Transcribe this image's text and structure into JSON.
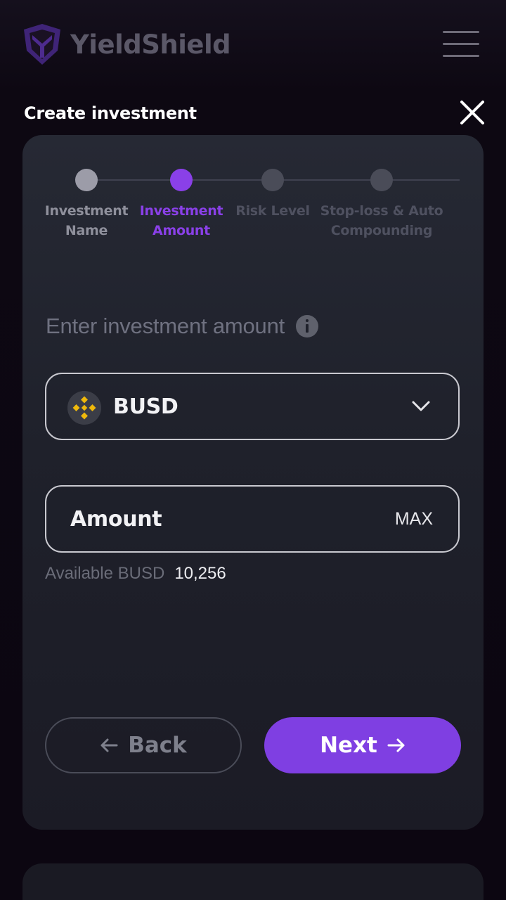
{
  "app": {
    "name": "YieldShield",
    "logo_icon": "shield-icon",
    "menu_icon": "hamburger-menu-icon"
  },
  "modal": {
    "title": "Create investment",
    "close_icon": "close-icon"
  },
  "stepper": {
    "steps": [
      {
        "label_line1": "Investment",
        "label_line2": "Name",
        "state": "done"
      },
      {
        "label_line1": "Investment",
        "label_line2": "Amount",
        "state": "active"
      },
      {
        "label_line1": "Risk Level",
        "label_line2": "",
        "state": "pending"
      },
      {
        "label_line1": "Stop-loss & Auto",
        "label_line2": "Compounding",
        "state": "pending"
      }
    ]
  },
  "form": {
    "prompt": "Enter investment amount",
    "info_icon": "info-icon",
    "token": {
      "symbol": "BUSD",
      "icon": "binance-icon",
      "dropdown_icon": "chevron-down-icon"
    },
    "amount_placeholder": "Amount",
    "max_label": "MAX",
    "available_label": "Available BUSD",
    "available_value": "10,256"
  },
  "actions": {
    "back_label": "Back",
    "next_label": "Next"
  },
  "colors": {
    "accent": "#8a40e8",
    "button_primary": "#7f3fe2",
    "binance_yellow": "#f0b90b",
    "logo_purple": "#4a2a86"
  }
}
